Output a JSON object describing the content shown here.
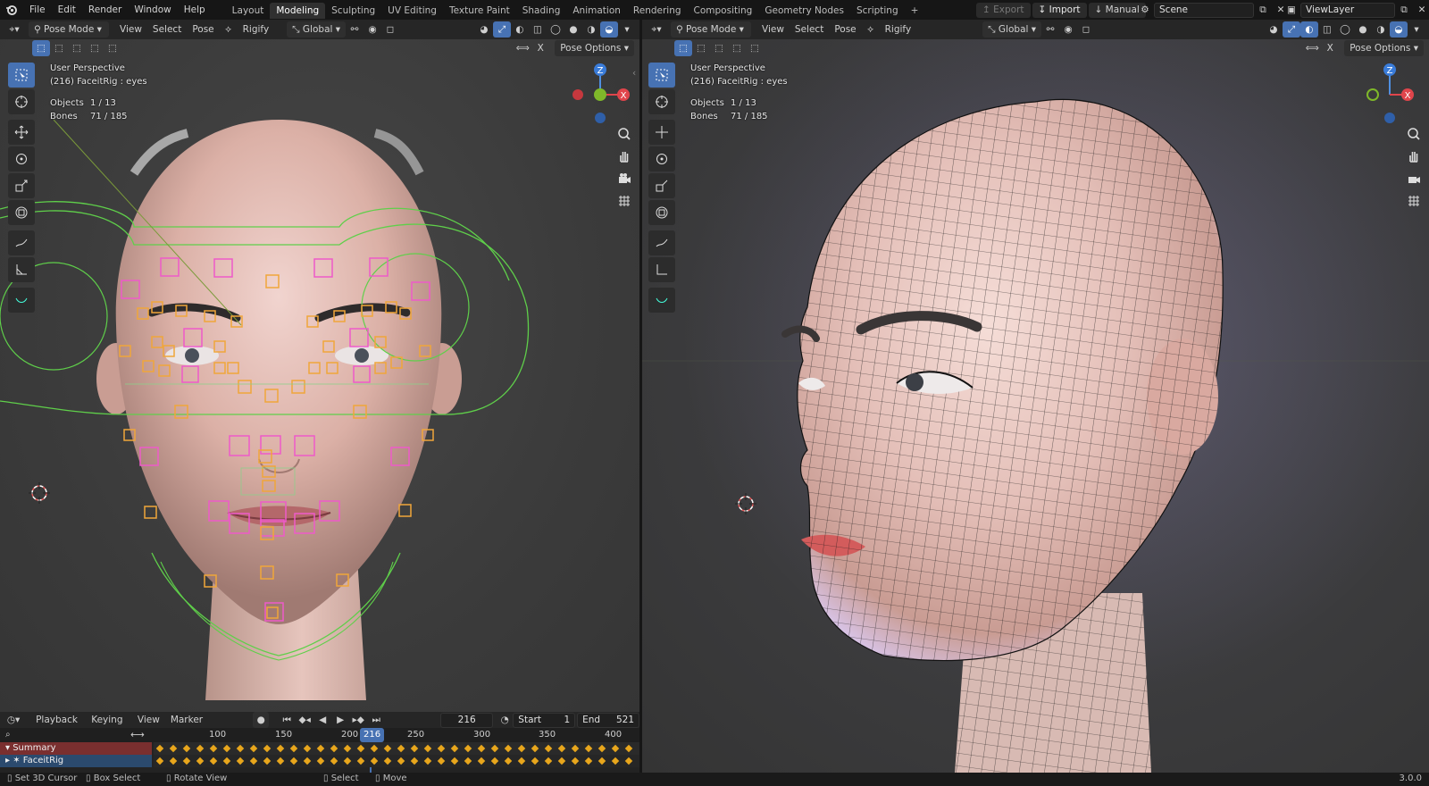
{
  "app": {
    "version": "3.0.0"
  },
  "top_menu": [
    "File",
    "Edit",
    "Render",
    "Window",
    "Help"
  ],
  "workspaces": [
    {
      "label": "Layout",
      "active": false
    },
    {
      "label": "Modeling",
      "active": true
    },
    {
      "label": "Sculpting",
      "active": false
    },
    {
      "label": "UV Editing",
      "active": false
    },
    {
      "label": "Texture Paint",
      "active": false
    },
    {
      "label": "Shading",
      "active": false
    },
    {
      "label": "Animation",
      "active": false
    },
    {
      "label": "Rendering",
      "active": false
    },
    {
      "label": "Compositing",
      "active": false
    },
    {
      "label": "Geometry Nodes",
      "active": false
    },
    {
      "label": "Scripting",
      "active": false
    }
  ],
  "top_right": {
    "export_label": "Export",
    "import_label": "Import",
    "manual_label": "Manual",
    "scene": "Scene",
    "view_layer": "ViewLayer"
  },
  "viewport_header": {
    "mode": "Pose Mode",
    "menus": [
      "View",
      "Select",
      "Pose"
    ],
    "rigify": "Rigify",
    "orientation": "Global",
    "pose_options": "Pose Options"
  },
  "viewport_overlay": {
    "perspective": "User Perspective",
    "active": "(216) FaceitRig : eyes",
    "objects_label": "Objects",
    "objects_value": "1 / 13",
    "bones_label": "Bones",
    "bones_value": "71 / 185"
  },
  "timeline": {
    "menus": [
      "Playback",
      "Keying",
      "View",
      "Marker"
    ],
    "current_frame": "216",
    "start_label": "Start",
    "start_value": "1",
    "end_label": "End",
    "end_value": "521",
    "ruler_ticks": [
      "100",
      "150",
      "200",
      "250",
      "300",
      "350",
      "400"
    ],
    "playhead": "216",
    "tracks": [
      "Summary",
      "FaceitRig"
    ]
  },
  "statusbar": {
    "items": [
      "Set 3D Cursor",
      "Box Select",
      "Rotate View",
      "Select",
      "Move"
    ]
  },
  "colors": {
    "accent": "#4772b3",
    "bg": "#3d3d3d",
    "header": "#262626",
    "keyframe": "#e8a61c",
    "summary_row": "#7a2f2f"
  },
  "icons": {
    "app": "blender-logo-icon",
    "axis_gizmo": "navigation-gizmo-icon"
  }
}
